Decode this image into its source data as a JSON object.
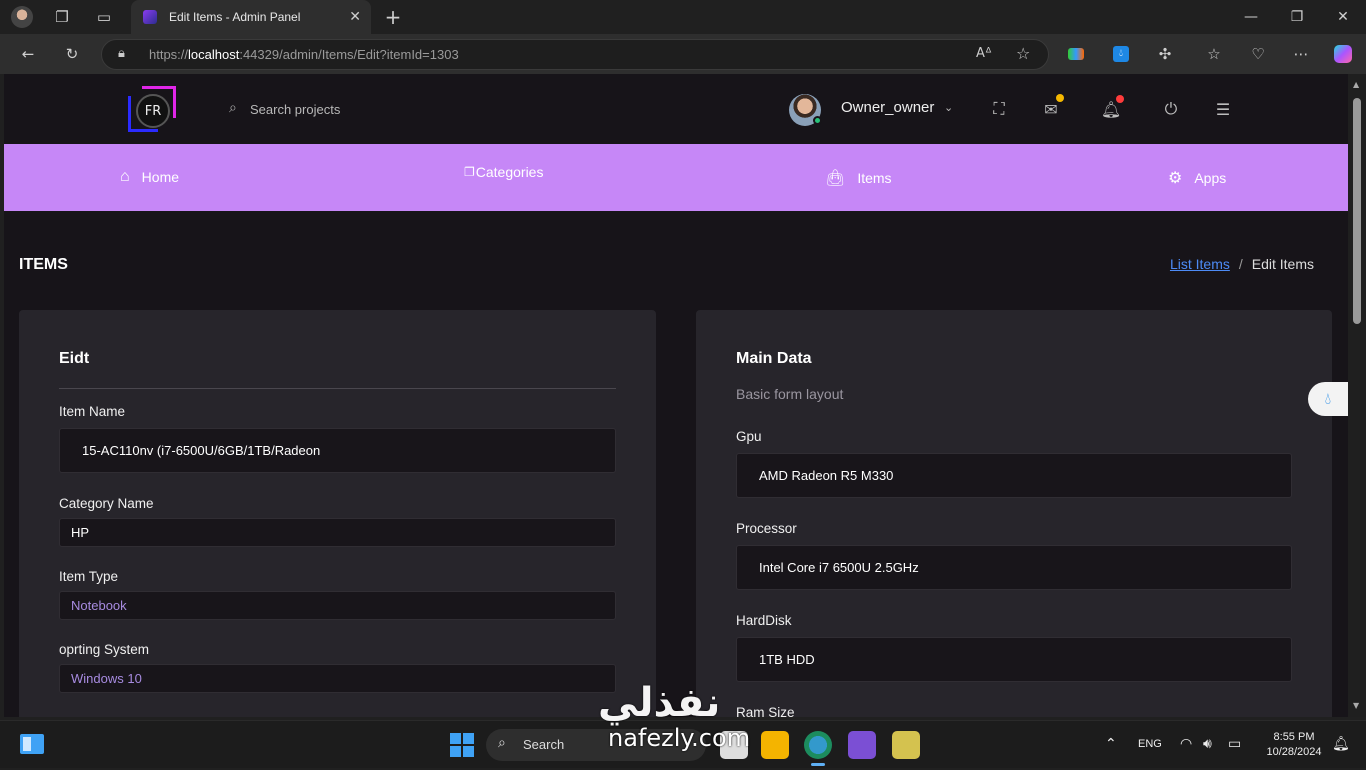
{
  "browser": {
    "tab_title": "Edit Items - Admin Panel",
    "url_prefix": "https://",
    "url_host": "localhost",
    "url_rest": ":44329/admin/Items/Edit?itemId=1303"
  },
  "header": {
    "logo_text": "FR",
    "search_placeholder": "Search projects",
    "username": "Owner_owner",
    "colors": {
      "mail_badge": "#f5b800",
      "bell_badge": "#ff3b3b",
      "status_dot": "#29c17a"
    }
  },
  "menu": {
    "bg_color": "#c687f7",
    "items": [
      {
        "label": "Home",
        "icon": "home-icon"
      },
      {
        "label": "Categories",
        "icon": "categories-icon"
      },
      {
        "label": "Items",
        "icon": "shopping-bag-icon"
      },
      {
        "label": "Apps",
        "icon": "gear-icon"
      }
    ]
  },
  "page": {
    "title": "ITEMS",
    "breadcrumb": {
      "link": "List Items",
      "separator": "/",
      "current": "Edit Items"
    }
  },
  "edit_card": {
    "title": "Eidt",
    "fields": [
      {
        "label": "Item Name",
        "value": "15-AC110nv (i7-6500U/6GB/1TB/Radeon"
      },
      {
        "label": "Category Name",
        "value": "HP"
      },
      {
        "label": "Item Type",
        "value": "Notebook"
      },
      {
        "label": "oprting System",
        "value": "Windows 10"
      }
    ]
  },
  "main_card": {
    "title": "Main Data",
    "subtitle": "Basic form layout",
    "fields": [
      {
        "label": "Gpu",
        "value": "AMD Radeon R5 M330"
      },
      {
        "label": "Processor",
        "value": "Intel Core i7 6500U 2.5GHz"
      },
      {
        "label": "HardDisk",
        "value": "1TB HDD"
      },
      {
        "label": "Ram Size",
        "value": ""
      }
    ]
  },
  "taskbar": {
    "search_label": "Search",
    "lang": "ENG",
    "time": "8:55 PM",
    "date": "10/28/2024"
  },
  "watermark": {
    "arabic": "نفذلي",
    "latin": "nafezly.com"
  }
}
